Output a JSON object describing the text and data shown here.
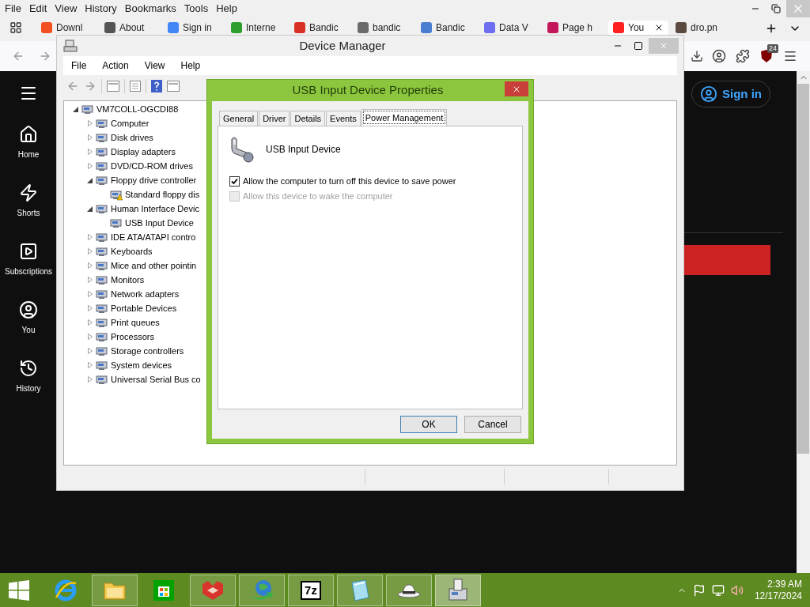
{
  "browser": {
    "menu": [
      "File",
      "Edit",
      "View",
      "History",
      "Bookmarks",
      "Tools",
      "Help"
    ],
    "tabs": [
      {
        "label": "Downl",
        "color": "#f25022",
        "selected": false
      },
      {
        "label": "About",
        "color": "#555555",
        "selected": false
      },
      {
        "label": "Sign in",
        "color": "#4285f4",
        "selected": false
      },
      {
        "label": "Interne",
        "color": "#2e9e2e",
        "selected": false
      },
      {
        "label": "Bandic",
        "color": "#d93025",
        "selected": false
      },
      {
        "label": "bandic",
        "color": "#6b6b6b",
        "selected": false
      },
      {
        "label": "Bandic",
        "color": "#4a7fd0",
        "selected": false
      },
      {
        "label": "Data V",
        "color": "#6d6df0",
        "selected": false
      },
      {
        "label": "Page h",
        "color": "#c2185b",
        "selected": false
      },
      {
        "label": "You",
        "color": "#ff2020",
        "selected": true
      },
      {
        "label": "dro.pn",
        "color": "#5a4a40",
        "selected": false
      }
    ],
    "extension_badge": "24"
  },
  "youtube": {
    "sidebar": [
      {
        "kind": "home",
        "label": "Home"
      },
      {
        "kind": "shorts",
        "label": "Shorts"
      },
      {
        "kind": "subscriptions",
        "label": "Subscriptions"
      },
      {
        "kind": "you",
        "label": "You"
      },
      {
        "kind": "history",
        "label": "History"
      }
    ],
    "sign_in": "Sign in"
  },
  "device_manager": {
    "title": "Device Manager",
    "menu": [
      "File",
      "Action",
      "View",
      "Help"
    ],
    "tree": {
      "label": "VM7COLL-OGCDI88",
      "expanded": true,
      "children": [
        {
          "label": "Computer",
          "expanded": false
        },
        {
          "label": "Disk drives",
          "expanded": false
        },
        {
          "label": "Display adapters",
          "expanded": false
        },
        {
          "label": "DVD/CD-ROM drives",
          "expanded": false
        },
        {
          "label": "Floppy drive controller",
          "expanded": true,
          "children": [
            {
              "label": "Standard floppy dis",
              "warning": true
            }
          ]
        },
        {
          "label": "Human Interface Devic",
          "expanded": true,
          "children": [
            {
              "label": "USB Input Device",
              "warning": false
            }
          ]
        },
        {
          "label": "IDE ATA/ATAPI contro",
          "expanded": false
        },
        {
          "label": "Keyboards",
          "expanded": false
        },
        {
          "label": "Mice and other pointin",
          "expanded": false
        },
        {
          "label": "Monitors",
          "expanded": false
        },
        {
          "label": "Network adapters",
          "expanded": false
        },
        {
          "label": "Portable Devices",
          "expanded": false
        },
        {
          "label": "Print queues",
          "expanded": false
        },
        {
          "label": "Processors",
          "expanded": false
        },
        {
          "label": "Storage controllers",
          "expanded": false
        },
        {
          "label": "System devices",
          "expanded": false
        },
        {
          "label": "Universal Serial Bus co",
          "expanded": false
        }
      ]
    }
  },
  "dialog": {
    "title": "USB Input Device Properties",
    "tabs": [
      {
        "label": "General",
        "selected": false
      },
      {
        "label": "Driver",
        "selected": false
      },
      {
        "label": "Details",
        "selected": false
      },
      {
        "label": "Events",
        "selected": false
      },
      {
        "label": "Power Management",
        "selected": true
      }
    ],
    "device_name": "USB Input Device",
    "options": [
      {
        "label": "Allow the computer to turn off this device to save power",
        "checked": true,
        "disabled": false
      },
      {
        "label": "Allow this device to wake the computer",
        "checked": false,
        "disabled": true
      }
    ],
    "buttons": [
      "OK",
      "Cancel"
    ]
  },
  "taskbar": {
    "apps": [
      {
        "kind": "browser",
        "running": false,
        "active": false
      },
      {
        "kind": "files",
        "running": true,
        "active": false
      },
      {
        "kind": "store",
        "running": false,
        "active": false
      },
      {
        "kind": "fox",
        "running": true,
        "active": false
      },
      {
        "kind": "download",
        "running": true,
        "active": false
      },
      {
        "kind": "archive",
        "label": "7z",
        "running": true,
        "active": false
      },
      {
        "kind": "notepad",
        "running": true,
        "active": false
      },
      {
        "kind": "hat",
        "running": true,
        "active": false
      },
      {
        "kind": "devices",
        "running": true,
        "active": true
      }
    ],
    "time": "2:39 AM",
    "date": "12/17/2024"
  }
}
